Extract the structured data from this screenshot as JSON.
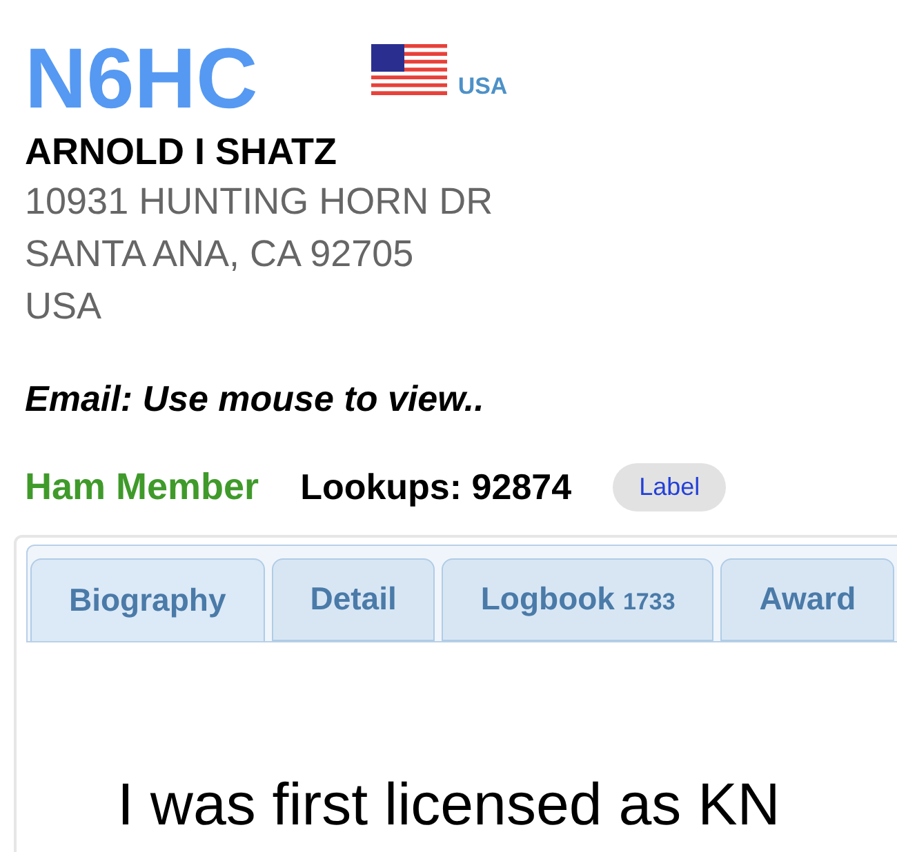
{
  "callsign": "N6HC",
  "country": "USA",
  "name": "ARNOLD I SHATZ",
  "address": [
    "10931 HUNTING HORN DR",
    "SANTA ANA, CA 92705",
    "USA"
  ],
  "email": "Email: Use mouse to view..",
  "membership": "Ham Member",
  "lookups": "Lookups: 92874",
  "label_button": "Label",
  "tabs": [
    {
      "label": "Biography",
      "selected": true
    },
    {
      "label": "Detail",
      "selected": false
    },
    {
      "label": "Logbook",
      "count": "1733",
      "selected": false
    },
    {
      "label": "Award",
      "selected": false
    }
  ],
  "biography": "I was first licensed as KN"
}
